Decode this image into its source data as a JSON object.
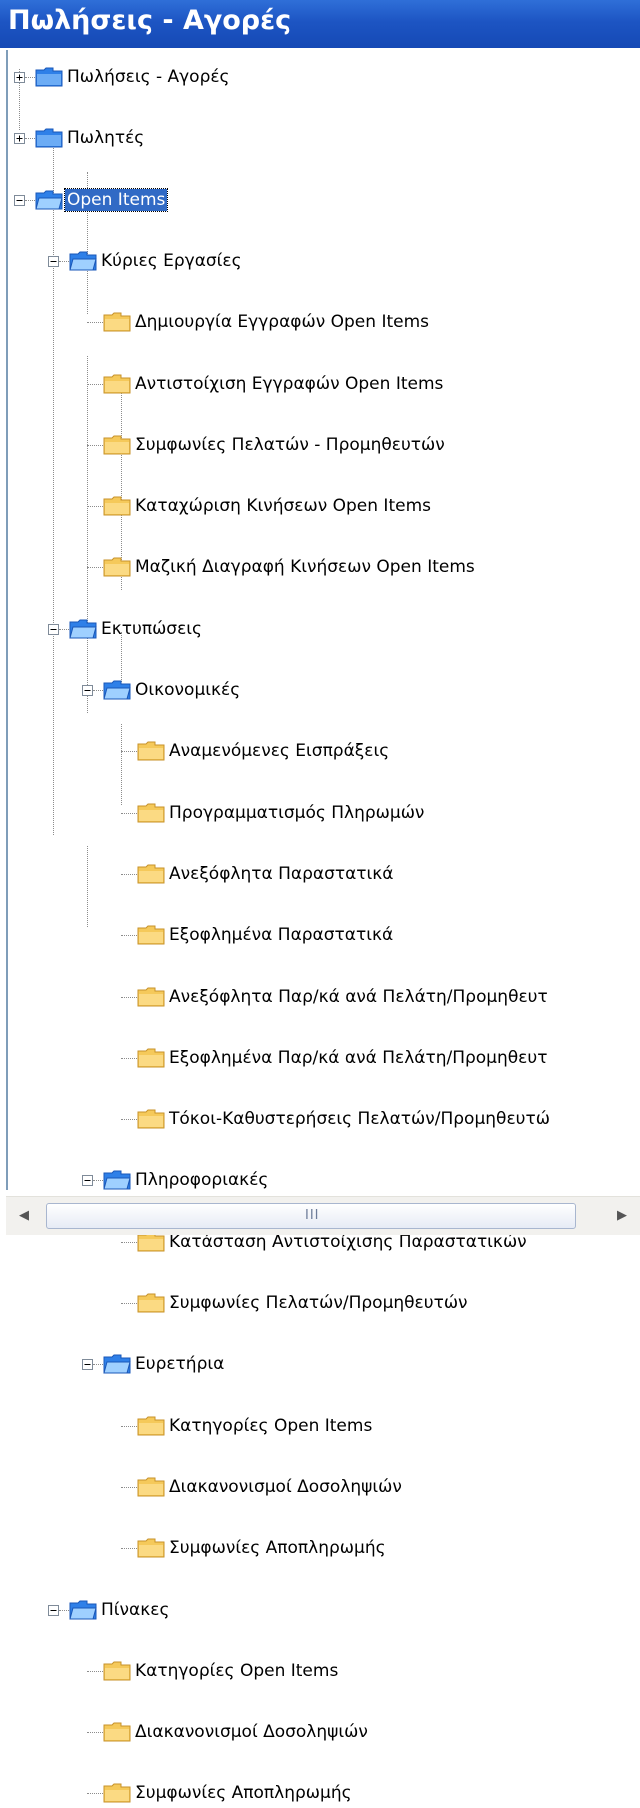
{
  "window": {
    "title": "Πωλήσεις - Αγορές"
  },
  "tree": [
    {
      "label": "Πωλήσεις - Αγορές",
      "expanded": false,
      "icon": "blue-folder-icon"
    },
    {
      "label": "Πωλητές",
      "expanded": false,
      "icon": "blue-folder-icon"
    },
    {
      "label": "Open Items",
      "expanded": true,
      "selected": true,
      "icon": "blue-folder-icon",
      "children": [
        {
          "label": "Κύριες Εργασίες",
          "expanded": true,
          "icon": "blue-folder-icon",
          "children": [
            {
              "label": "Δημιουργία Εγγραφών Open Items",
              "icon": "yellow-folder-icon"
            },
            {
              "label": "Αντιστοίχιση Εγγραφών Open Items",
              "icon": "yellow-folder-icon"
            },
            {
              "label": "Συμφωνίες Πελατών - Προμηθευτών",
              "icon": "yellow-folder-icon"
            },
            {
              "label": "Καταχώριση Κινήσεων Open Items",
              "icon": "yellow-folder-icon"
            },
            {
              "label": "Μαζική Διαγραφή Κινήσεων Open Items",
              "icon": "yellow-folder-icon"
            }
          ]
        },
        {
          "label": "Εκτυπώσεις",
          "expanded": true,
          "icon": "blue-folder-icon",
          "children": [
            {
              "label": "Οικονομικές",
              "expanded": true,
              "icon": "blue-folder-icon",
              "children": [
                {
                  "label": "Αναμενόμενες Εισπράξεις",
                  "icon": "yellow-folder-icon"
                },
                {
                  "label": "Προγραμματισμός Πληρωμών",
                  "icon": "yellow-folder-icon"
                },
                {
                  "label": "Ανεξόφλητα Παραστατικά",
                  "icon": "yellow-folder-icon"
                },
                {
                  "label": "Εξοφλημένα Παραστατικά",
                  "icon": "yellow-folder-icon"
                },
                {
                  "label": "Ανεξόφλητα Παρ/κά ανά Πελάτη/Προμηθευτ",
                  "icon": "yellow-folder-icon"
                },
                {
                  "label": "Εξοφλημένα Παρ/κά ανά Πελάτη/Προμηθευτ",
                  "icon": "yellow-folder-icon"
                },
                {
                  "label": "Τόκοι-Καθυστερήσεις Πελατών/Προμηθευτώ",
                  "icon": "yellow-folder-icon"
                }
              ]
            },
            {
              "label": "Πληροφοριακές",
              "expanded": true,
              "icon": "blue-folder-icon",
              "children": [
                {
                  "label": "Κατάσταση Αντιστοίχισης Παραστατικών",
                  "icon": "yellow-folder-icon"
                },
                {
                  "label": "Συμφωνίες Πελατών/Προμηθευτών",
                  "icon": "yellow-folder-icon"
                }
              ]
            },
            {
              "label": "Ευρετήρια",
              "expanded": true,
              "icon": "blue-folder-icon",
              "children": [
                {
                  "label": "Κατηγορίες Open Items",
                  "icon": "yellow-folder-icon"
                },
                {
                  "label": "Διακανονισμοί Δοσοληψιών",
                  "icon": "yellow-folder-icon"
                },
                {
                  "label": "Συμφωνίες Αποπληρωμής",
                  "icon": "yellow-folder-icon"
                }
              ]
            }
          ]
        },
        {
          "label": "Πίνακες",
          "expanded": true,
          "icon": "blue-folder-icon",
          "children": [
            {
              "label": "Κατηγορίες Open Items",
              "icon": "yellow-folder-icon"
            },
            {
              "label": "Διακανονισμοί Δοσοληψιών",
              "icon": "yellow-folder-icon"
            },
            {
              "label": "Συμφωνίες Αποπληρωμής",
              "icon": "yellow-folder-icon"
            }
          ]
        }
      ]
    }
  ],
  "scrollbar": {
    "left_icon": "scroll-left-arrow-icon",
    "right_icon": "scroll-right-arrow-icon",
    "grip": "III"
  },
  "colors": {
    "title_bar": "#1d55c3",
    "selection": "#316ac5",
    "blue_folder": "#2f80e8",
    "yellow_folder": "#f5c95a"
  }
}
